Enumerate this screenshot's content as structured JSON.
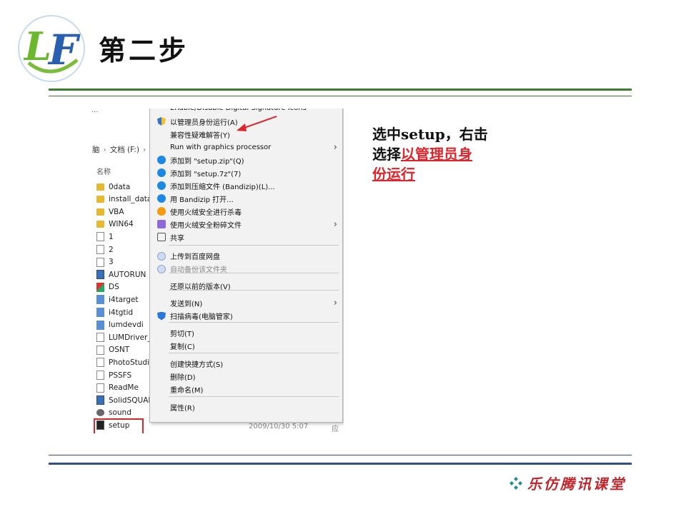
{
  "slide": {
    "title": "第二步",
    "logo_text": "LF",
    "footer_brand": "乐仿腾讯课堂"
  },
  "instruction": {
    "line1": "选中setup，右击",
    "line2_prefix": "选择",
    "highlight": "以管理员身份运行"
  },
  "explorer": {
    "top_cut_text": "...",
    "breadcrumb": [
      "脑",
      "文档 (F:)"
    ],
    "column_header": "名称",
    "files": [
      {
        "name": "0data",
        "icon": "folder-icon"
      },
      {
        "name": "install_data",
        "icon": "folder-icon"
      },
      {
        "name": "VBA",
        "icon": "folder-icon"
      },
      {
        "name": "WIN64",
        "icon": "folder-icon"
      },
      {
        "name": "1",
        "icon": "document-icon"
      },
      {
        "name": "2",
        "icon": "document-icon"
      },
      {
        "name": "3",
        "icon": "document-icon"
      },
      {
        "name": "AUTORUN",
        "icon": "autorun-icon"
      },
      {
        "name": "DS",
        "icon": "ds-icon"
      },
      {
        "name": "i4target",
        "icon": "system-file-icon"
      },
      {
        "name": "i4tgtid",
        "icon": "system-file-icon"
      },
      {
        "name": "lumdevdi",
        "icon": "system-file-icon"
      },
      {
        "name": "LUMDriver_(",
        "icon": "document-icon"
      },
      {
        "name": "OSNT",
        "icon": "document-icon"
      },
      {
        "name": "PhotoStudio",
        "icon": "document-icon"
      },
      {
        "name": "PSSFS",
        "icon": "document-icon"
      },
      {
        "name": "ReadMe",
        "icon": "document-icon"
      },
      {
        "name": "SolidSQUAD",
        "icon": "app-icon"
      },
      {
        "name": "sound",
        "icon": "sound-icon"
      },
      {
        "name": "setup",
        "icon": "setup-icon"
      }
    ],
    "selected_date": "2009/10/30 5:07",
    "selected_type": "应"
  },
  "context_menu": {
    "items": [
      {
        "label": "Enable/Disable Digital Signature Icons",
        "icon": "",
        "submenu": false,
        "disabled": false
      },
      {
        "label": "以管理员身份运行(A)",
        "icon": "uac-shield-icon",
        "submenu": false,
        "disabled": false
      },
      {
        "label": "兼容性疑难解答(Y)",
        "icon": "",
        "submenu": false,
        "disabled": false
      },
      {
        "label": "Run with graphics processor",
        "icon": "",
        "submenu": true,
        "disabled": false
      },
      {
        "label": "添加到 \"setup.zip\"(Q)",
        "icon": "bandizip-icon",
        "submenu": false,
        "disabled": false
      },
      {
        "label": "添加到 \"setup.7z\"(7)",
        "icon": "bandizip-icon",
        "submenu": false,
        "disabled": false
      },
      {
        "label": "添加到压缩文件 (Bandizip)(L)...",
        "icon": "bandizip-icon",
        "submenu": false,
        "disabled": false
      },
      {
        "label": "用 Bandizip 打开...",
        "icon": "bandizip-icon",
        "submenu": false,
        "disabled": false
      },
      {
        "label": "使用火绒安全进行杀毒",
        "icon": "huorong-icon",
        "submenu": false,
        "disabled": false
      },
      {
        "label": "使用火绒安全粉碎文件",
        "icon": "shredder-icon",
        "submenu": true,
        "disabled": false
      },
      {
        "label": "共享",
        "icon": "share-icon",
        "submenu": false,
        "disabled": false
      },
      {
        "label": "上传到百度网盘",
        "icon": "baidu-cloud-icon",
        "submenu": false,
        "disabled": false
      },
      {
        "label": "自动备份该文件夹",
        "icon": "baidu-cloud-icon",
        "submenu": false,
        "disabled": true
      },
      {
        "label": "还原以前的版本(V)",
        "icon": "",
        "submenu": false,
        "disabled": false
      },
      {
        "label": "发送到(N)",
        "icon": "",
        "submenu": true,
        "disabled": false
      },
      {
        "label": "扫描病毒(电脑管家)",
        "icon": "pc-manager-icon",
        "submenu": false,
        "disabled": false
      },
      {
        "label": "剪切(T)",
        "icon": "",
        "submenu": false,
        "disabled": false
      },
      {
        "label": "复制(C)",
        "icon": "",
        "submenu": false,
        "disabled": false
      },
      {
        "label": "创建快捷方式(S)",
        "icon": "",
        "submenu": false,
        "disabled": false
      },
      {
        "label": "删除(D)",
        "icon": "",
        "submenu": false,
        "disabled": false
      },
      {
        "label": "重命名(M)",
        "icon": "",
        "submenu": false,
        "disabled": false
      },
      {
        "label": "属性(R)",
        "icon": "",
        "submenu": false,
        "disabled": false
      }
    ]
  },
  "colors": {
    "accent_red": "#e0242b",
    "header_rule_green": "#3a7d2c",
    "footer_rule_blue": "#2f4f8a",
    "brand_red": "#c0262b"
  }
}
